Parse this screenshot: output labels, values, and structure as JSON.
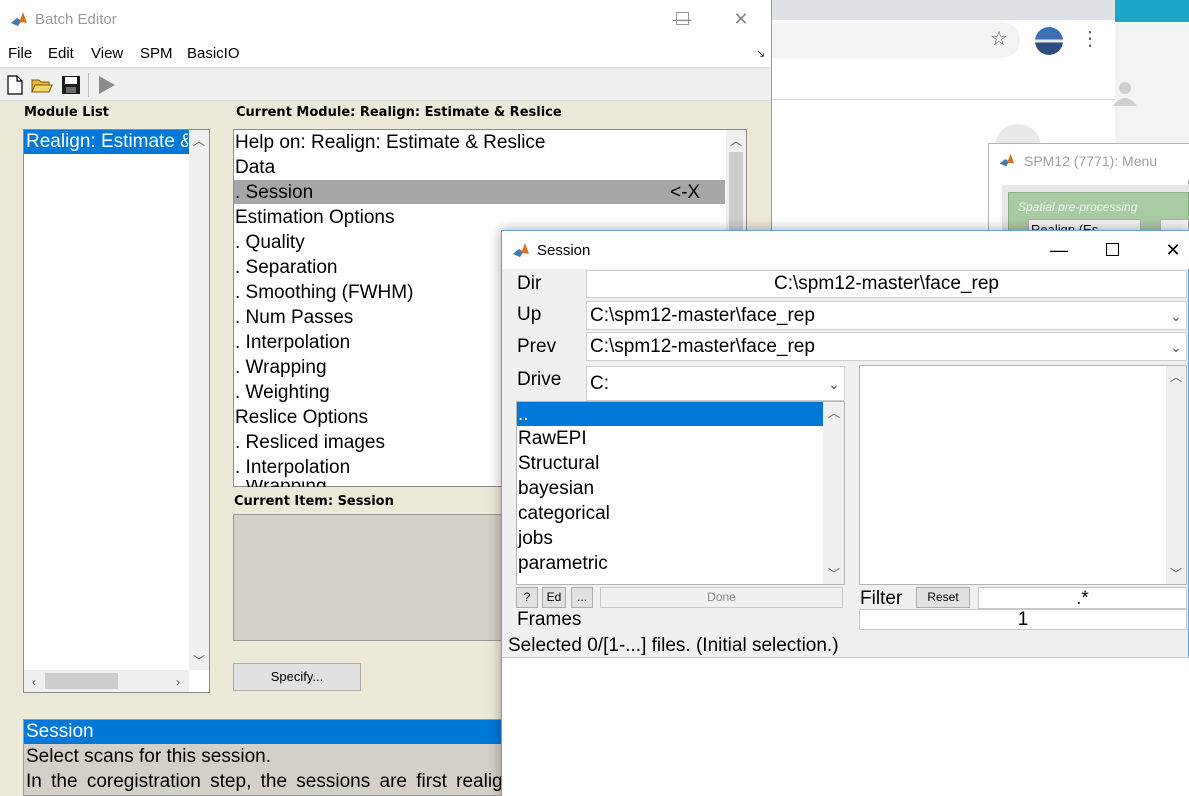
{
  "browser": {
    "accent_colors": {
      "strip": "#1aa5c9"
    }
  },
  "spm_menu": {
    "title": "SPM12 (7771): Menu",
    "panel_label": "Spatial pre-processing",
    "dropdown_value": "Realign (Es"
  },
  "batch_editor": {
    "title": "Batch Editor",
    "menu": [
      "File",
      "Edit",
      "View",
      "SPM",
      "BasicIO"
    ],
    "module_list_label": "Module List",
    "module_list_items": [
      "Realign: Estimate & Reslice"
    ],
    "current_module_label": "Current Module: Realign: Estimate & Reslice",
    "current_module_lines": [
      "Help on: Realign: Estimate & Reslice",
      "Data",
      ". Session",
      "Estimation Options",
      ". Quality",
      ". Separation",
      ". Smoothing (FWHM)",
      ". Num Passes",
      ". Interpolation",
      ". Wrapping",
      ". Weighting",
      "Reslice Options",
      ". Resliced images",
      ". Interpolation",
      ". Wrapping"
    ],
    "selected_line_marker": "<-X",
    "current_item_label": "Current Item: Session",
    "specify_button": "Specify...",
    "help": {
      "title": "Session",
      "line1": "Select scans for this session.",
      "line2": "In the coregistration step, the sessions are first realigned"
    }
  },
  "session": {
    "title": "Session",
    "dir_label": "Dir",
    "dir_value": "C:\\spm12-master\\face_rep",
    "up_label": "Up",
    "up_value": "C:\\spm12-master\\face_rep",
    "prev_label": "Prev",
    "prev_value": "C:\\spm12-master\\face_rep",
    "drive_label": "Drive",
    "drive_value": "C:",
    "directories": [
      "..",
      "RawEPI",
      "Structural",
      "bayesian",
      "categorical",
      "jobs",
      "parametric"
    ],
    "buttons": {
      "help": "?",
      "edit": "Ed",
      "more": "...",
      "done": "Done",
      "reset": "Reset"
    },
    "filter_label": "Filter",
    "filter_value": ".*",
    "frames_label": "Frames",
    "frames_value": "1",
    "selected_text": "Selected 0/[1-...] files. (Initial selection.)"
  }
}
